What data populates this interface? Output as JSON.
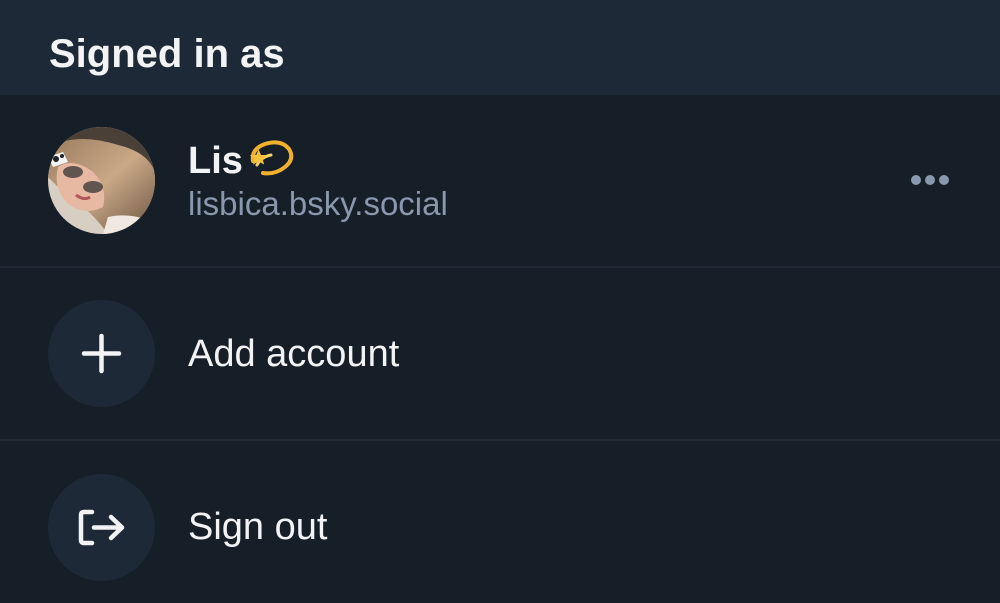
{
  "header": {
    "title": "Signed in as"
  },
  "account": {
    "display_name": "Lis",
    "name_emoji": "dizzy-star-emoji",
    "handle": "lisbica.bsky.social",
    "avatar": "user-avatar-photo",
    "more_icon": "ellipsis-icon"
  },
  "actions": {
    "add_account": {
      "label": "Add account",
      "icon": "plus-icon"
    },
    "sign_out": {
      "label": "Sign out",
      "icon": "sign-out-icon"
    }
  },
  "colors": {
    "background": "#161e27",
    "header_background": "#1e2937",
    "icon_circle": "#1e2937",
    "primary_text": "#f1f3f5",
    "secondary_text": "#8a98ad",
    "divider": "#212b38"
  }
}
